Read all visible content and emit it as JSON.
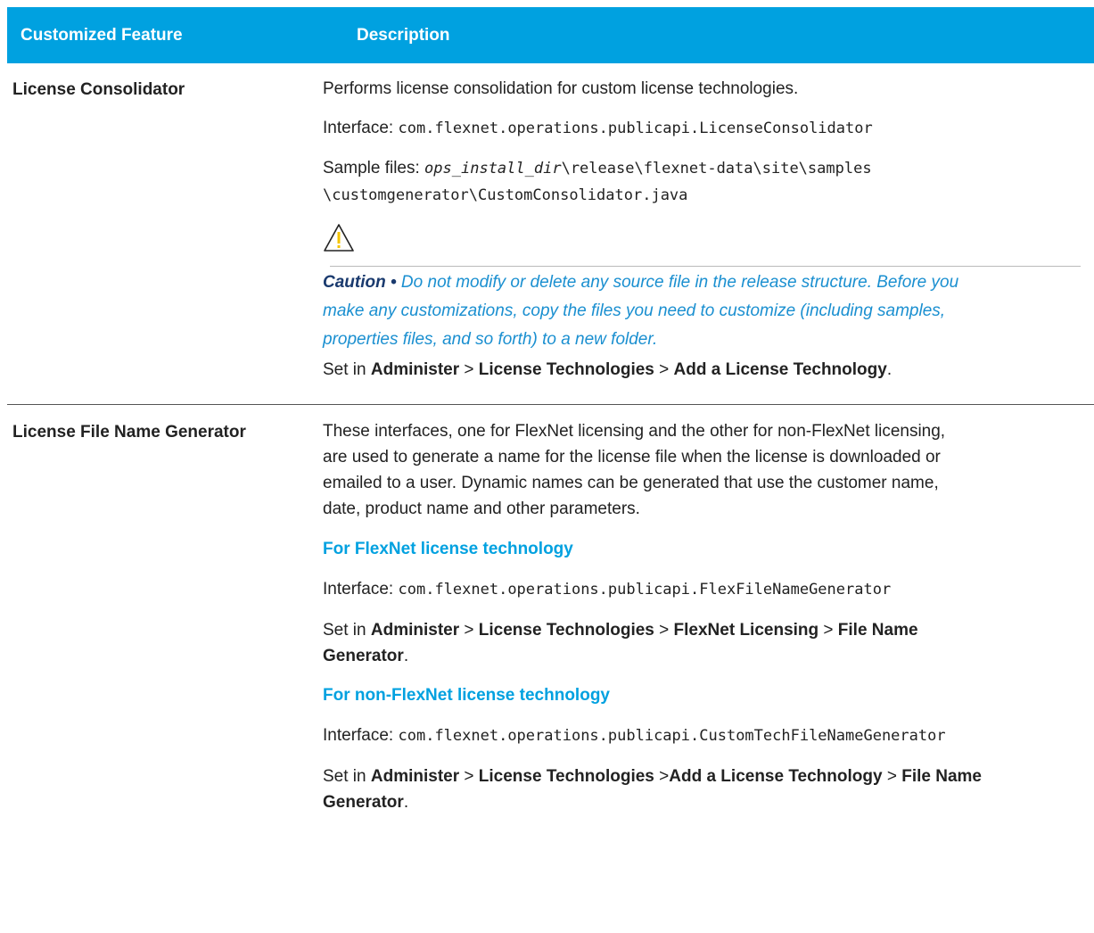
{
  "header": {
    "col1": "Customized Feature",
    "col2": "Description"
  },
  "rows": [
    {
      "feature": "License Consolidator",
      "p1": "Performs license consolidation for custom license technologies.",
      "interface_label": "Interface: ",
      "interface_value": "com.flexnet.operations.publicapi.LicenseConsolidator",
      "sample_label": "Sample files: ",
      "sample_dir": "ops_install_dir",
      "sample_path1": "\\release\\flexnet-data\\site\\samples",
      "sample_path2": "\\customgenerator\\CustomConsolidator.java",
      "caution_label": "Caution •",
      "caution_text1": " Do not modify or delete any source file in the release structure. Before you",
      "caution_text2": "make any customizations, copy the files you need to customize (including samples,",
      "caution_text3": "properties files, and so forth) to a new folder.",
      "set_in": {
        "prefix": "Set in ",
        "a": "Administer",
        "sep1": " > ",
        "b": "License Technologies",
        "sep2": " > ",
        "c": "Add a License Technology",
        "end": "."
      }
    },
    {
      "feature": "License File Name Generator",
      "p1_line1": "These interfaces, one for FlexNet licensing and the other for non-FlexNet licensing,",
      "p1_line2": "are used to generate a name for the license file when the license is downloaded or",
      "p1_line3": "emailed to a user. Dynamic names can be generated that use the customer name,",
      "p1_line4": "date, product name and other parameters.",
      "sub1": "For FlexNet license technology",
      "interface_label": "Interface: ",
      "interface1": "com.flexnet.operations.publicapi.FlexFileNameGenerator",
      "set1": {
        "prefix": "Set in ",
        "a": "Administer",
        "sep1": " > ",
        "b": "License Technologies",
        "sep2": " > ",
        "c": "FlexNet Licensing",
        "sep3": " > ",
        "d": "File Name",
        "d2": "Generator",
        "end": "."
      },
      "sub2": "For non-FlexNet license technology",
      "interface2": "com.flexnet.operations.publicapi.CustomTechFileNameGenerator",
      "set2": {
        "prefix": "Set in ",
        "a": "Administer",
        "sep1": " > ",
        "b": "License Technologies",
        "sep2": " >",
        "c": "Add a License Technology",
        "sep3": " > ",
        "d": "File Name",
        "d2": "Generator",
        "end": "."
      }
    }
  ]
}
